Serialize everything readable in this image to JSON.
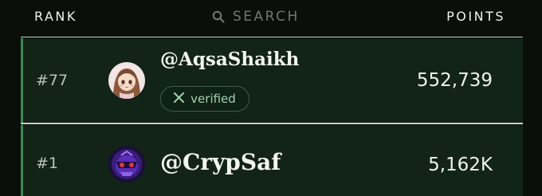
{
  "header": {
    "rank_label": "RANK",
    "search_placeholder": "SEARCH",
    "points_label": "POINTS"
  },
  "rows": [
    {
      "rank": "#77",
      "handle": "@AqsaShaikh",
      "badge": "verified",
      "badge_icon": "x-logo-icon",
      "points": "552,739",
      "avatar": "anime-girl-avatar"
    },
    {
      "rank": "#1",
      "handle": "@CrypSaf",
      "points": "5,162K",
      "avatar": "purple-mask-avatar"
    }
  ],
  "colors": {
    "background": "#0a0f0a",
    "row_background": "#112417",
    "accent": "#3c8a54",
    "badge_text": "#9ed3ad"
  }
}
